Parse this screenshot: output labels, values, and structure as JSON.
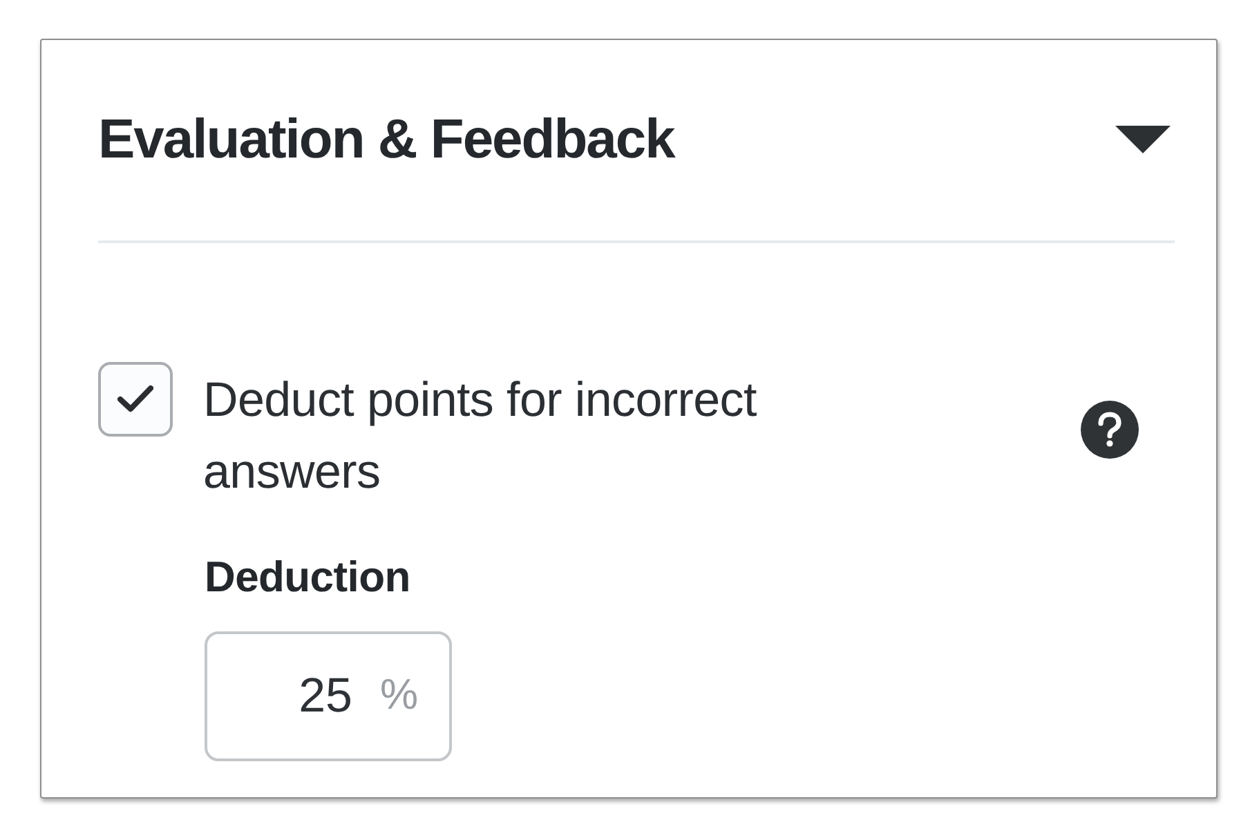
{
  "section": {
    "title": "Evaluation & Feedback",
    "expanded": true
  },
  "options": [
    {
      "kind": "checkbox",
      "label": "Deduct points for incorrect answers",
      "checked": true
    }
  ],
  "deduction": {
    "label": "Deduction",
    "value": "25",
    "unit": "%"
  }
}
